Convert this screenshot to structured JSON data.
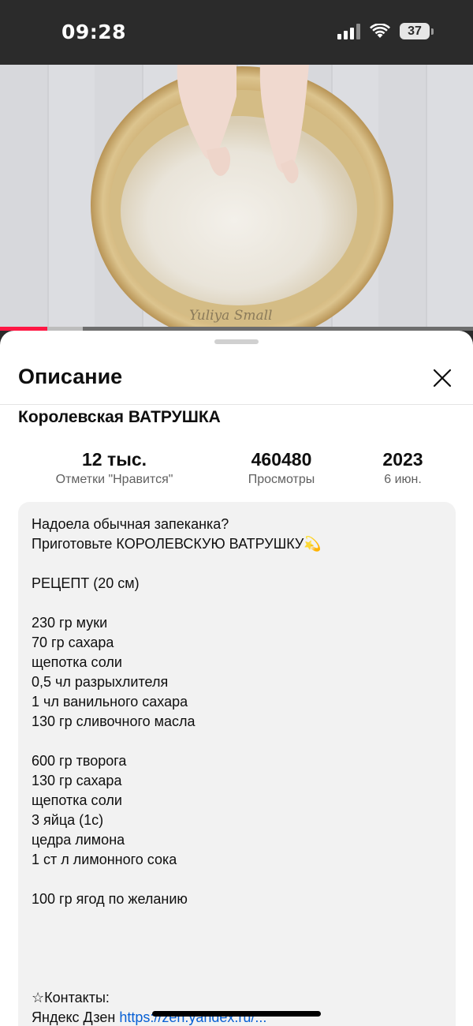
{
  "status_bar": {
    "time": "09:28",
    "battery": "37"
  },
  "video": {
    "watermark": "Yuliya Small",
    "progress_percent": 10,
    "buffered_percent": 17.5
  },
  "sheet": {
    "title": "Описание",
    "video_title": "Королевская ВАТРУШКА",
    "stats": {
      "likes_value": "12 тыс.",
      "likes_label": "Отметки \"Нравится\"",
      "views_value": "460480",
      "views_label": "Просмотры",
      "year_value": "2023",
      "date_label": "6 июн."
    },
    "description": {
      "lines": [
        "Надоела обычная запеканка?",
        "Приготовьте КОРОЛЕВСКУЮ ВАТРУШКУ💫",
        "",
        "РЕЦЕПТ (20 см)",
        "",
        "230 гр муки",
        "70 гр сахара",
        "щепотка соли",
        "0,5 чл разрыхлителя",
        "1 чл ванильного сахара",
        "130 гр сливочного масла",
        "",
        "600 гр творога",
        "130 гр сахара",
        "щепотка соли",
        "3 яйца (1с)",
        "цедра лимона",
        "1 ст л лимонного сока",
        "",
        "100 гр ягод по желанию",
        "",
        "",
        "",
        "",
        "☆Контакты:"
      ],
      "contact_prefix": "Яндекс Дзен ",
      "contact_link": "https://zen.yandex.ru/..."
    }
  },
  "colors": {
    "accent": "#ff1744",
    "link": "#065fd4",
    "sheet_bg": "#ffffff",
    "desc_bg": "#f2f2f2"
  }
}
